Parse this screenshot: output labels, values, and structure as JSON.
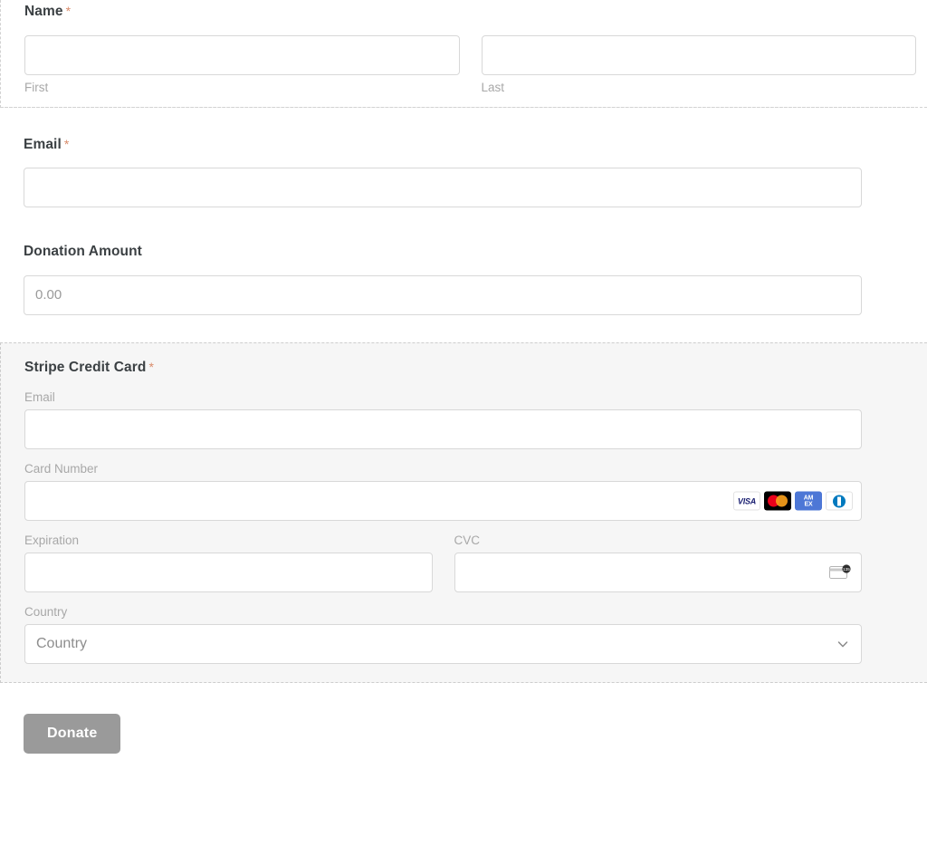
{
  "form": {
    "required_marker": "*",
    "accent_required_color": "#d98b6a",
    "fields": {
      "name": {
        "label": "Name",
        "required": true,
        "first": {
          "sublabel": "First",
          "value": "",
          "placeholder": ""
        },
        "last": {
          "sublabel": "Last",
          "value": "",
          "placeholder": ""
        }
      },
      "email": {
        "label": "Email",
        "required": true,
        "value": "",
        "placeholder": ""
      },
      "donation_amount": {
        "label": "Donation Amount",
        "required": false,
        "value": "",
        "placeholder": "0.00"
      }
    },
    "stripe": {
      "label": "Stripe Credit Card",
      "required": true,
      "email": {
        "sublabel": "Email",
        "value": "",
        "placeholder": ""
      },
      "card_number": {
        "sublabel": "Card Number",
        "value": "",
        "placeholder": "",
        "brands": [
          {
            "name": "visa-icon",
            "text": "VISA",
            "bg": "#ffffff",
            "fg": "#1a1f71"
          },
          {
            "name": "mastercard-icon",
            "text": "",
            "bg": "#000000",
            "fg": "#eb001b"
          },
          {
            "name": "amex-icon",
            "line1": "AM",
            "line2": "EX",
            "bg": "#4d77d6",
            "fg": "#ffffff"
          },
          {
            "name": "diners-club-icon",
            "text": "",
            "bg": "#ffffff",
            "fg": "#0079be"
          }
        ]
      },
      "expiration": {
        "sublabel": "Expiration",
        "value": "",
        "placeholder": ""
      },
      "cvc": {
        "sublabel": "CVC",
        "value": "",
        "placeholder": "",
        "hint_digits": "135"
      },
      "country": {
        "sublabel": "Country",
        "selected": "Country",
        "placeholder": "Country"
      }
    },
    "submit": {
      "label": "Donate",
      "bg": "#9a9a9a",
      "fg": "#ffffff"
    }
  }
}
